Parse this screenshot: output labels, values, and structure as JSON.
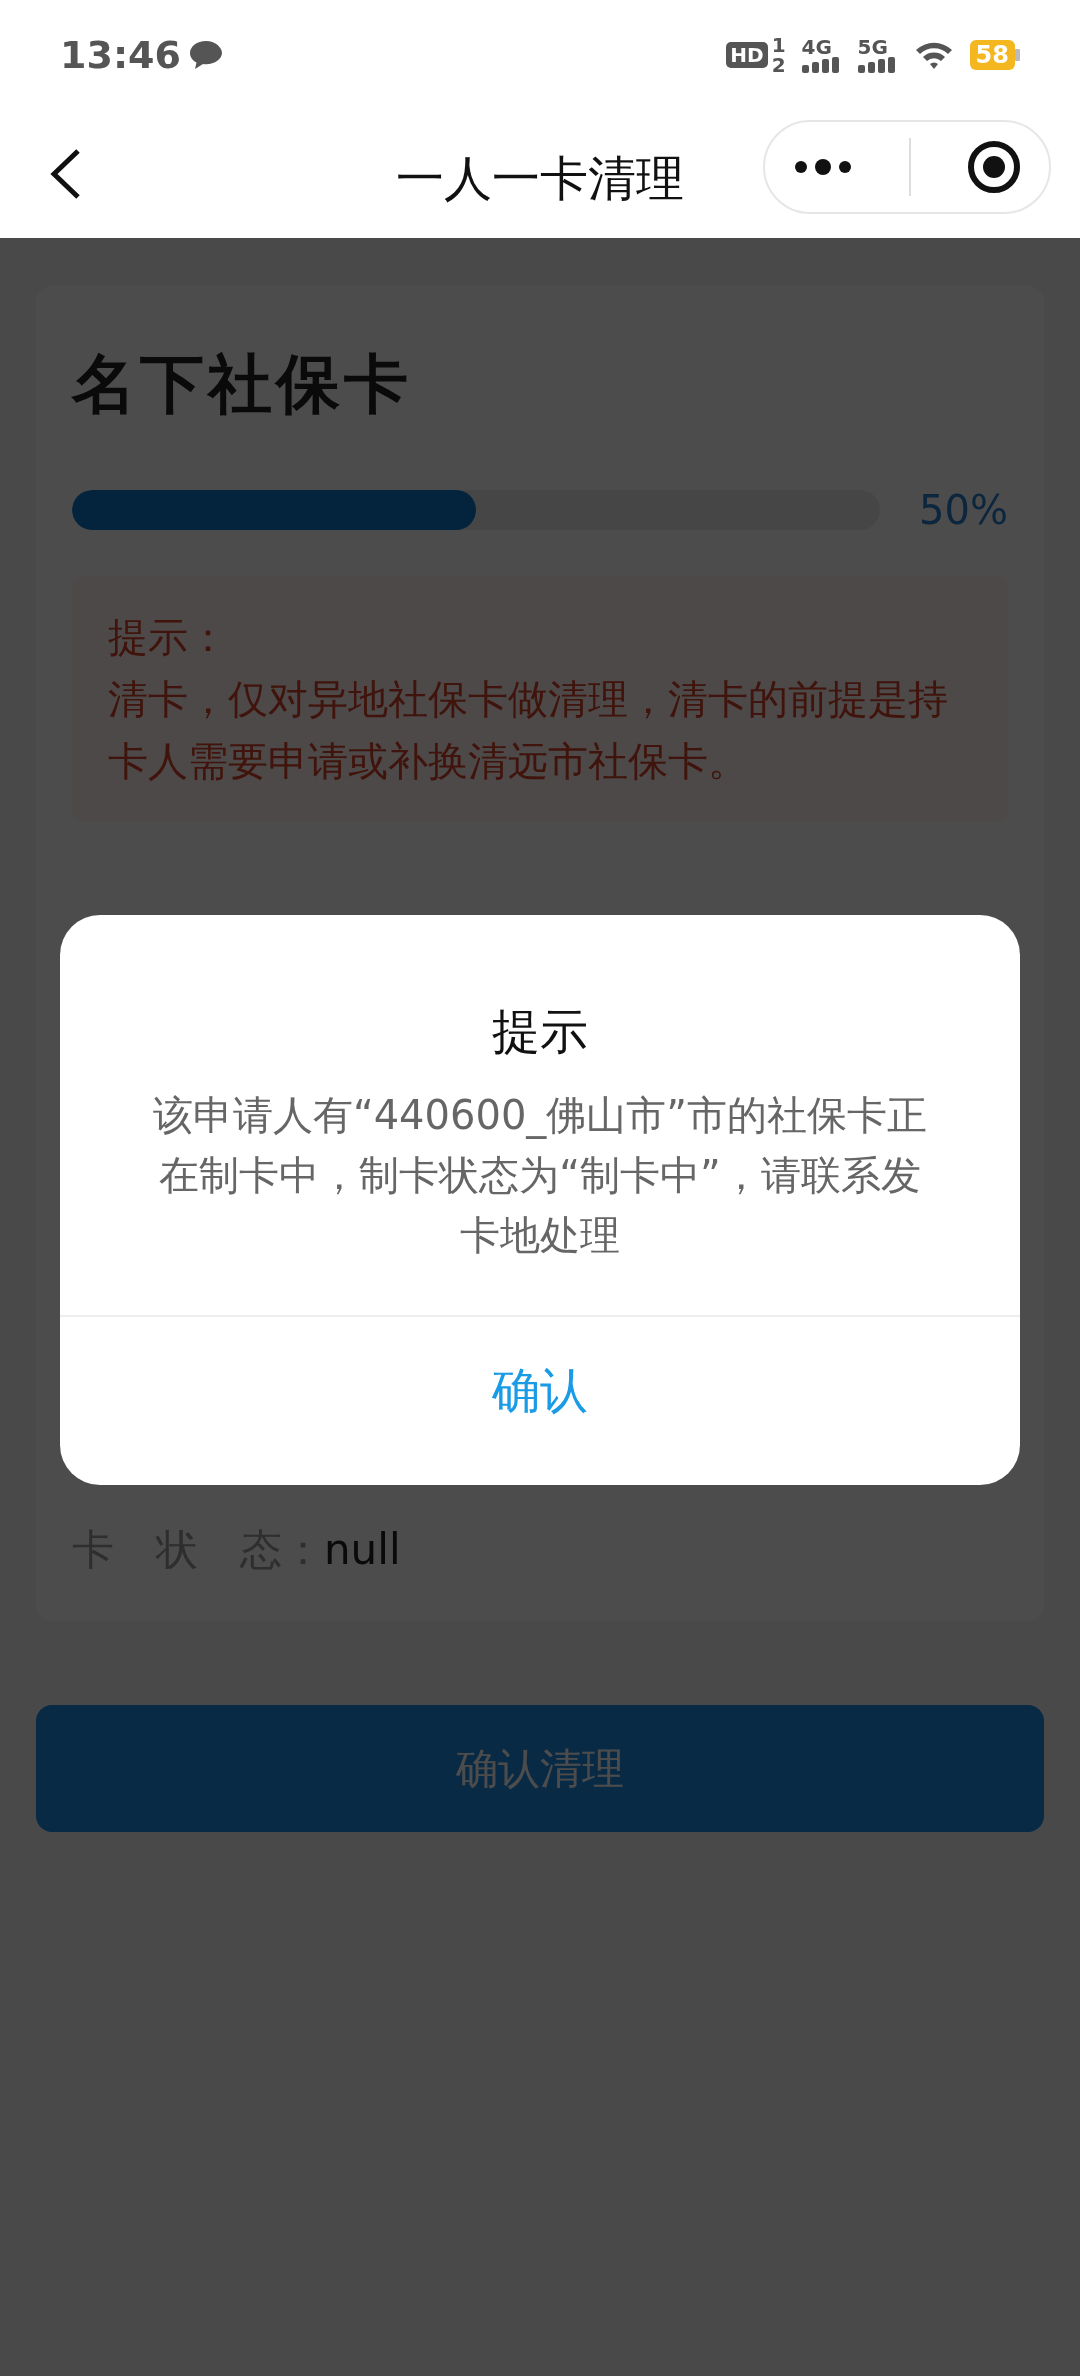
{
  "status_bar": {
    "time": "13:46",
    "hd": "HD",
    "sim_slots": [
      "1",
      "2"
    ],
    "networks": [
      "4G",
      "5G"
    ],
    "battery": "58"
  },
  "nav": {
    "title": "一人一卡清理"
  },
  "card": {
    "title": "名下社保卡",
    "progress": {
      "level": 0.5,
      "reading": "50%"
    },
    "tip": {
      "label": "提示：",
      "text": "清卡，仅对异地社保卡做清理，清卡的前提是持卡人需要申请或补换清远市社保卡。"
    },
    "fields": [
      {
        "label": "卡　状　态：",
        "value": "null"
      }
    ]
  },
  "primary_button": "确认清理",
  "dialog": {
    "title": "提示",
    "message": "该申请人有“440600_佛山市”市的社保卡正在制卡中，制卡状态为“制卡中”，请联系发卡地处理",
    "button": "确认"
  }
}
